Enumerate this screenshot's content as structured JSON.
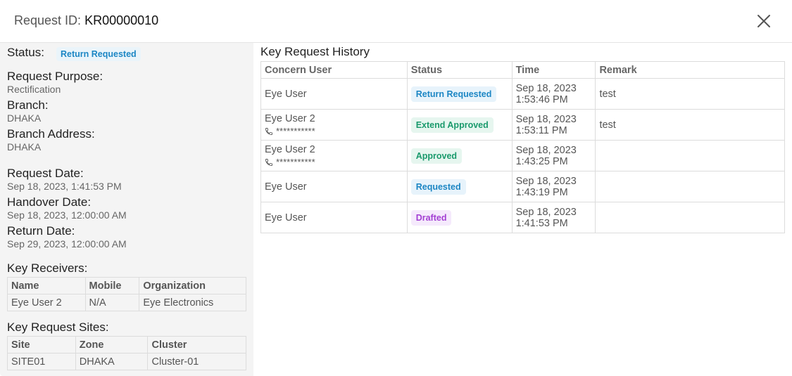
{
  "header": {
    "title_label": "Request ID:",
    "request_id": "KR00000010"
  },
  "details": {
    "status_label": "Status:",
    "status_value": "Return Requested",
    "purpose_label": "Request Purpose:",
    "purpose_value": "Rectification",
    "branch_label": "Branch:",
    "branch_value": "DHAKA",
    "branch_address_label": "Branch Address:",
    "branch_address_value": "DHAKA",
    "request_date_label": "Request Date:",
    "request_date_value": "Sep 18, 2023, 1:41:53 PM",
    "handover_date_label": "Handover Date:",
    "handover_date_value": "Sep 18, 2023, 12:00:00 AM",
    "return_date_label": "Return Date:",
    "return_date_value": "Sep 29, 2023, 12:00:00 AM"
  },
  "receivers": {
    "label": "Key Receivers:",
    "columns": [
      "Name",
      "Mobile",
      "Organization"
    ],
    "rows": [
      [
        "Eye User 2",
        "N/A",
        "Eye Electronics"
      ]
    ]
  },
  "sites": {
    "label": "Key Request Sites:",
    "columns": [
      "Site",
      "Zone",
      "Cluster"
    ],
    "rows": [
      [
        "SITE01",
        "DHAKA",
        "Cluster-01"
      ]
    ]
  },
  "history": {
    "label": "Key Request History",
    "columns": [
      "Concern User",
      "Status",
      "Time",
      "Remark"
    ],
    "rows": [
      {
        "user": "Eye User",
        "phone": "",
        "status": "Return Requested",
        "status_color": "blue",
        "date": "Sep 18, 2023",
        "time": "1:53:46 PM",
        "remark": "test"
      },
      {
        "user": "Eye User 2",
        "phone": "***********",
        "status": "Extend Approved",
        "status_color": "green",
        "date": "Sep 18, 2023",
        "time": "1:53:11 PM",
        "remark": "test"
      },
      {
        "user": "Eye User 2",
        "phone": "***********",
        "status": "Approved",
        "status_color": "green",
        "date": "Sep 18, 2023",
        "time": "1:43:25 PM",
        "remark": ""
      },
      {
        "user": "Eye User",
        "phone": "",
        "status": "Requested",
        "status_color": "blue",
        "date": "Sep 18, 2023",
        "time": "1:43:19 PM",
        "remark": ""
      },
      {
        "user": "Eye User",
        "phone": "",
        "status": "Drafted",
        "status_color": "purple",
        "date": "Sep 18, 2023",
        "time": "1:41:53 PM",
        "remark": ""
      }
    ]
  },
  "colors": {
    "blue": "#1c86c4",
    "green": "#1a9a6c",
    "purple": "#a33fd3"
  }
}
